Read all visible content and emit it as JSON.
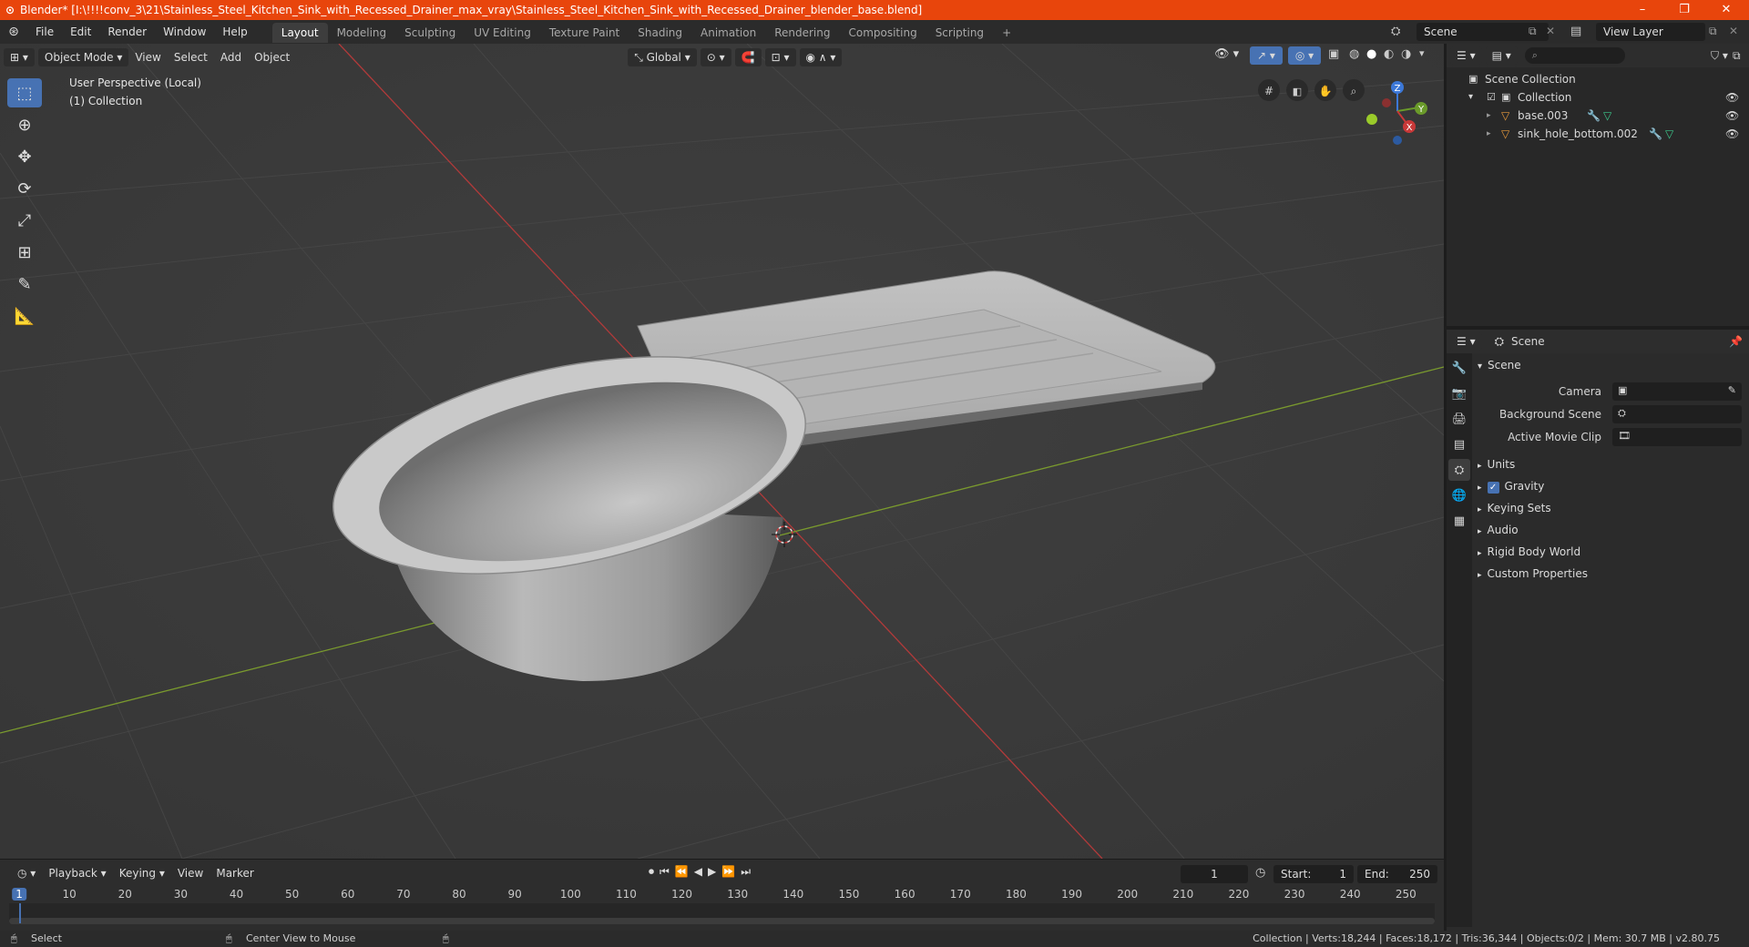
{
  "window": {
    "title": "Blender* [I:\\!!!!conv_3\\21\\Stainless_Steel_Kitchen_Sink_with_Recessed_Drainer_max_vray\\Stainless_Steel_Kitchen_Sink_with_Recessed_Drainer_blender_base.blend]",
    "controls": [
      "–",
      "❐",
      "✕"
    ]
  },
  "menu": [
    "File",
    "Edit",
    "Render",
    "Window",
    "Help"
  ],
  "workspaces": [
    "Layout",
    "Modeling",
    "Sculpting",
    "UV Editing",
    "Texture Paint",
    "Shading",
    "Animation",
    "Rendering",
    "Compositing",
    "Scripting"
  ],
  "workspace_add": "+",
  "scene_selector": "Scene",
  "view_layer_selector": "View Layer",
  "viewport": {
    "mode": "Object Mode",
    "menus": [
      "View",
      "Select",
      "Add",
      "Object"
    ],
    "transform_orientation": "Global",
    "info_line1": "User Perspective (Local)",
    "info_line2": "(1) Collection",
    "gizmo_axes": {
      "z": "Z",
      "y": "Y",
      "x": "X"
    }
  },
  "toolbar_tools": [
    "select-box",
    "cursor",
    "move",
    "rotate",
    "scale",
    "transform",
    "annotate",
    "measure"
  ],
  "timeline": {
    "menus": [
      "Playback",
      "Keying",
      "View",
      "Marker"
    ],
    "current_frame": "1",
    "start_label": "Start:",
    "start": "1",
    "end_label": "End:",
    "end": "250",
    "ticks": [
      "1",
      "10",
      "20",
      "30",
      "40",
      "50",
      "60",
      "70",
      "80",
      "90",
      "100",
      "110",
      "120",
      "130",
      "140",
      "150",
      "160",
      "170",
      "180",
      "190",
      "200",
      "210",
      "220",
      "230",
      "240",
      "250"
    ]
  },
  "status": {
    "left_action": "Select",
    "mid_action": "Center View to Mouse",
    "right": "Collection | Verts:18,244 | Faces:18,172 | Tris:36,344 | Objects:0/2 | Mem: 30.7 MB | v2.80.75"
  },
  "outliner": {
    "root": "Scene Collection",
    "collection": "Collection",
    "objects": [
      "base.003",
      "sink_hole_bottom.002"
    ]
  },
  "properties": {
    "context": "Scene",
    "panel_title": "Scene",
    "camera_label": "Camera",
    "background_scene_label": "Background Scene",
    "active_movie_clip_label": "Active Movie Clip",
    "subpanels": [
      "Units",
      "Gravity",
      "Keying Sets",
      "Audio",
      "Rigid Body World",
      "Custom Properties"
    ],
    "gravity_checked": true
  },
  "colors": {
    "title_bar": "#e8450c",
    "active_tool": "#4772b3",
    "axis_x": "#c83838",
    "axis_y": "#6a9a2a",
    "axis_z": "#3c78d8"
  }
}
